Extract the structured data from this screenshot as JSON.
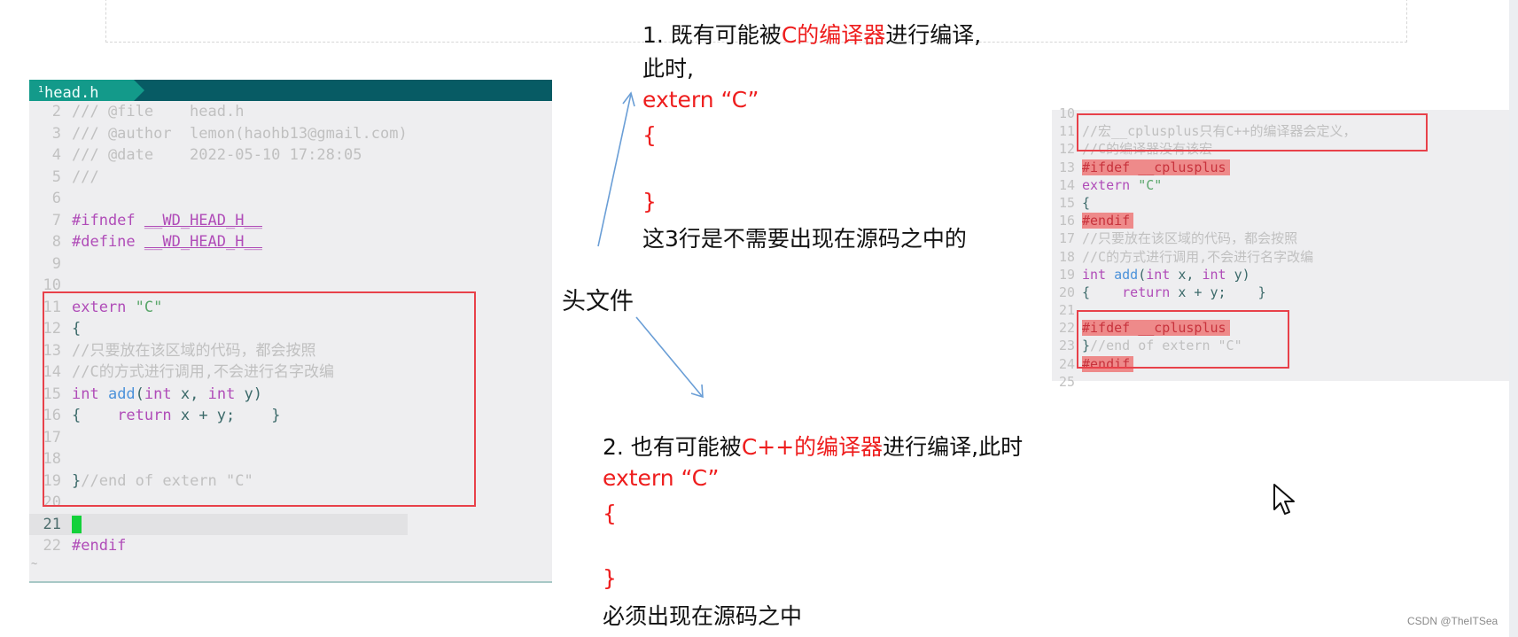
{
  "editor_left": {
    "tab_number": "1",
    "tab_label": "head.h",
    "lines": [
      {
        "n": "2",
        "parts": [
          [
            "cm",
            "/// @file    head.h"
          ]
        ]
      },
      {
        "n": "3",
        "parts": [
          [
            "cm",
            "/// @author  lemon(haohb13@gmail.com)"
          ]
        ]
      },
      {
        "n": "4",
        "parts": [
          [
            "cm",
            "/// @date    2022-05-10 17:28:05"
          ]
        ]
      },
      {
        "n": "5",
        "parts": [
          [
            "cm",
            "///"
          ]
        ]
      },
      {
        "n": "6",
        "parts": []
      },
      {
        "n": "7",
        "parts": [
          [
            "pp",
            "#ifndef "
          ],
          [
            "macro",
            "__WD_HEAD_H__"
          ]
        ]
      },
      {
        "n": "8",
        "parts": [
          [
            "pp",
            "#define "
          ],
          [
            "macro",
            "__WD_HEAD_H__"
          ]
        ]
      },
      {
        "n": "9",
        "parts": []
      },
      {
        "n": "10",
        "parts": []
      },
      {
        "n": "11",
        "parts": [
          [
            "kw",
            "extern "
          ],
          [
            "str",
            "\"C\""
          ]
        ]
      },
      {
        "n": "12",
        "parts": [
          [
            "id",
            "{"
          ]
        ]
      },
      {
        "n": "13",
        "parts": [
          [
            "cm",
            "//只要放在该区域的代码，都会按照"
          ]
        ]
      },
      {
        "n": "14",
        "parts": [
          [
            "cm",
            "//C的方式进行调用,不会进行名字改编"
          ]
        ]
      },
      {
        "n": "15",
        "parts": [
          [
            "kw",
            "int "
          ],
          [
            "fn",
            "add"
          ],
          [
            "id",
            "("
          ],
          [
            "kw",
            "int "
          ],
          [
            "id",
            "x, "
          ],
          [
            "kw",
            "int "
          ],
          [
            "id",
            "y)"
          ]
        ]
      },
      {
        "n": "16",
        "parts": [
          [
            "id",
            "{    "
          ],
          [
            "kw",
            "return "
          ],
          [
            "id",
            "x + y;    }"
          ]
        ]
      },
      {
        "n": "17",
        "parts": []
      },
      {
        "n": "18",
        "parts": []
      },
      {
        "n": "19",
        "parts": [
          [
            "id",
            "}"
          ],
          [
            "cm",
            "//end of extern \"C\""
          ]
        ]
      },
      {
        "n": "20",
        "parts": []
      },
      {
        "n": "21",
        "parts": [],
        "current": true
      },
      {
        "n": "22",
        "parts": [
          [
            "pp",
            "#endif"
          ]
        ]
      }
    ],
    "tilde": "~"
  },
  "editor_right": {
    "lines": [
      {
        "n": "10",
        "parts": []
      },
      {
        "n": "11",
        "parts": [
          [
            "cm",
            "//宏__cplusplus只有C++的编译器会定义，"
          ]
        ]
      },
      {
        "n": "12",
        "parts": [
          [
            "cm",
            "//C的编译器没有该宏"
          ]
        ]
      },
      {
        "n": "13",
        "parts": [
          [
            "hl",
            "#ifdef __cplusplus"
          ]
        ]
      },
      {
        "n": "14",
        "parts": [
          [
            "kw",
            "extern "
          ],
          [
            "str",
            "\"C\""
          ]
        ]
      },
      {
        "n": "15",
        "parts": [
          [
            "id",
            "{"
          ]
        ]
      },
      {
        "n": "16",
        "parts": [
          [
            "hl",
            "#endif"
          ]
        ]
      },
      {
        "n": "17",
        "parts": [
          [
            "cm",
            "//只要放在该区域的代码，都会按照"
          ]
        ]
      },
      {
        "n": "18",
        "parts": [
          [
            "cm",
            "//C的方式进行调用,不会进行名字改编"
          ]
        ]
      },
      {
        "n": "19",
        "parts": [
          [
            "kw",
            "int "
          ],
          [
            "fn",
            "add"
          ],
          [
            "id",
            "("
          ],
          [
            "kw",
            "int "
          ],
          [
            "id",
            "x, "
          ],
          [
            "kw",
            "int "
          ],
          [
            "id",
            "y)"
          ]
        ]
      },
      {
        "n": "20",
        "parts": [
          [
            "id",
            "{    "
          ],
          [
            "kw",
            "return "
          ],
          [
            "id",
            "x + y;    }"
          ]
        ]
      },
      {
        "n": "21",
        "parts": []
      },
      {
        "n": "22",
        "parts": [
          [
            "hl",
            "#ifdef __cplusplus"
          ]
        ]
      },
      {
        "n": "23",
        "parts": [
          [
            "id",
            "}"
          ],
          [
            "cm",
            "//end of extern \"C\""
          ]
        ]
      },
      {
        "n": "24",
        "parts": [
          [
            "hl",
            "#endif"
          ]
        ]
      },
      {
        "n": "25",
        "parts": []
      }
    ]
  },
  "slide": {
    "case1": {
      "prefix": "1. 既有可能被",
      "highlight": "C的编译器",
      "suffix": "进行编译,",
      "line2": "此时,",
      "code1": "extern “C”",
      "code2": "{",
      "code3": "}",
      "note": "这3行是不需要出现在源码之中的"
    },
    "header_label": "头文件",
    "case2": {
      "prefix": "2. 也有可能被",
      "highlight": "C++的编译器",
      "suffix": "进行编译,此时",
      "code1": "extern “C”",
      "code2": "{",
      "code3": "}",
      "note": "必须出现在源码之中"
    }
  },
  "watermark": "CSDN @TheITSea",
  "colors": {
    "tab_bg": "#139a8a",
    "tabbar_bg": "#075b64",
    "accent_red": "#ee1d1d",
    "arrow_blue": "#6a9ed6",
    "cursor_green": "#13d13a"
  }
}
